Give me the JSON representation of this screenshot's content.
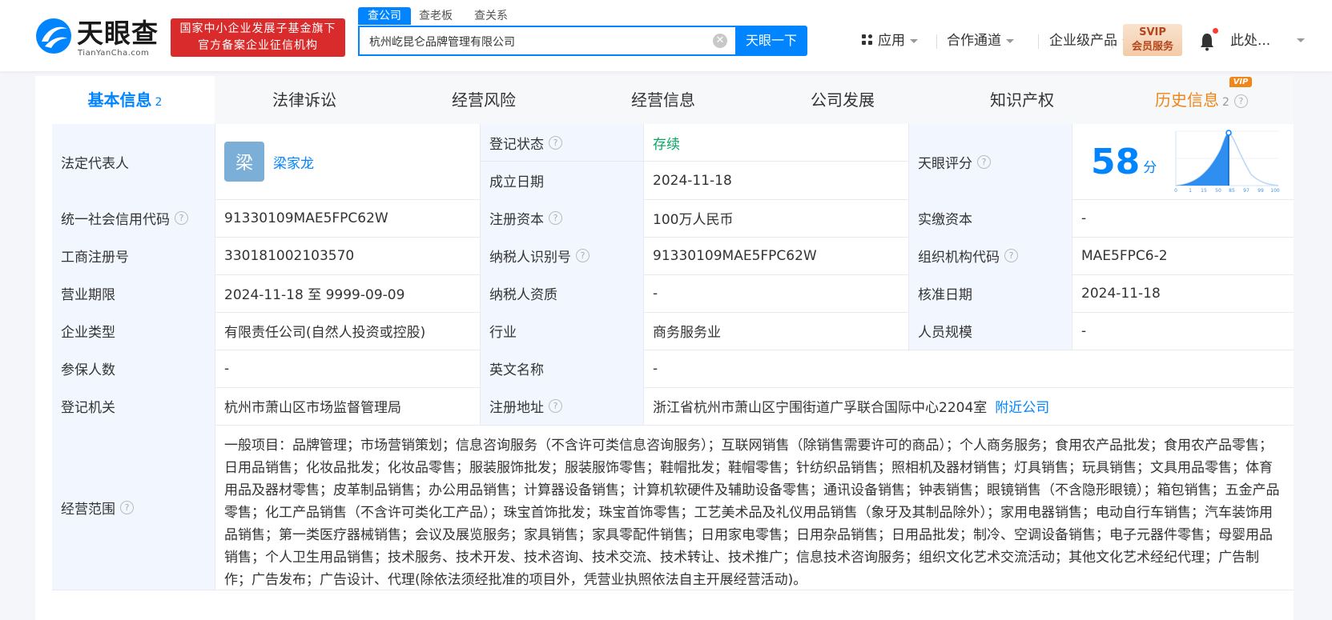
{
  "header": {
    "logo_cn": "天眼查",
    "logo_en": "TianYanCha.com",
    "badge_line1": "国家中小企业发展子基金旗下",
    "badge_line2": "官方备案企业征信机构",
    "search_tabs": [
      "查公司",
      "查老板",
      "查关系"
    ],
    "search_value": "杭州屹昆仑品牌管理有限公司",
    "search_button": "天眼一下",
    "nav": [
      "应用",
      "合作通道",
      "企业级产品"
    ],
    "svip_line1": "SVIP",
    "svip_line2": "会员服务",
    "user": "此处..."
  },
  "tabs": [
    {
      "label": "基本信息",
      "count": "2"
    },
    {
      "label": "法律诉讼"
    },
    {
      "label": "经营风险"
    },
    {
      "label": "经营信息"
    },
    {
      "label": "公司发展"
    },
    {
      "label": "知识产权"
    },
    {
      "label": "历史信息",
      "count": "2",
      "vip": "VIP"
    }
  ],
  "info": {
    "legal_rep_label": "法定代表人",
    "legal_rep_avatar": "梁",
    "legal_rep_name": "梁家龙",
    "reg_status_label": "登记状态",
    "reg_status": "存续",
    "est_date_label": "成立日期",
    "est_date": "2024-11-18",
    "rating_label": "天眼评分",
    "rating_score": "58",
    "rating_unit": "分",
    "rating_axis": [
      "0",
      "1",
      "15",
      "50",
      "85",
      "97",
      "99",
      "100"
    ],
    "credit_code_label": "统一社会信用代码",
    "credit_code": "91330109MAE5FPC62W",
    "reg_capital_label": "注册资本",
    "reg_capital": "100万人民币",
    "paid_capital_label": "实缴资本",
    "paid_capital": "-",
    "biz_reg_no_label": "工商注册号",
    "biz_reg_no": "330181002103570",
    "taxpayer_id_label": "纳税人识别号",
    "taxpayer_id": "91330109MAE5FPC62W",
    "org_code_label": "组织机构代码",
    "org_code": "MAE5FPC6-2",
    "term_label": "营业期限",
    "term": "2024-11-18 至 9999-09-09",
    "taxpayer_qual_label": "纳税人资质",
    "taxpayer_qual": "-",
    "approval_date_label": "核准日期",
    "approval_date": "2024-11-18",
    "type_label": "企业类型",
    "type": "有限责任公司(自然人投资或控股)",
    "industry_label": "行业",
    "industry": "商务服务业",
    "staff_label": "人员规模",
    "staff": "-",
    "insured_label": "参保人数",
    "insured": "-",
    "en_name_label": "英文名称",
    "en_name": "-",
    "authority_label": "登记机关",
    "authority": "杭州市萧山区市场监督管理局",
    "address_label": "注册地址",
    "address": "浙江省杭州市萧山区宁围街道广孚联合国际中心2204室",
    "nearby": "附近公司",
    "scope_label": "经营范围",
    "scope": "一般项目：品牌管理；市场营销策划；信息咨询服务（不含许可类信息咨询服务）；互联网销售（除销售需要许可的商品）；个人商务服务；食用农产品批发；食用农产品零售；日用品销售；化妆品批发；化妆品零售；服装服饰批发；服装服饰零售；鞋帽批发；鞋帽零售；针纺织品销售；照相机及器材销售；灯具销售；玩具销售；文具用品零售；体育用品及器材零售；皮革制品销售；办公用品销售；计算器设备销售；计算机软硬件及辅助设备零售；通讯设备销售；钟表销售；眼镜销售（不含隐形眼镜）；箱包销售；五金产品零售；化工产品销售（不含许可类化工产品）；珠宝首饰批发；珠宝首饰零售；工艺美术品及礼仪用品销售（象牙及其制品除外）；家用电器销售；电动自行车销售；汽车装饰用品销售；第一类医疗器械销售；会议及展览服务；家具销售；家具零配件销售；日用家电零售；日用杂品销售；日用品批发；制冷、空调设备销售；电子元器件零售；母婴用品销售；个人卫生用品销售；技术服务、技术开发、技术咨询、技术交流、技术转让、技术推广；信息技术咨询服务；组织文化艺术交流活动；其他文化艺术经纪代理；广告制作；广告发布；广告设计、代理(除依法须经批准的项目外，凭营业执照依法自主开展经营活动)。"
  },
  "colors": {
    "accent": "#0084ff",
    "status_green": "#07a863",
    "badge_red": "#d92b2b",
    "vip_orange": "#f08519"
  }
}
